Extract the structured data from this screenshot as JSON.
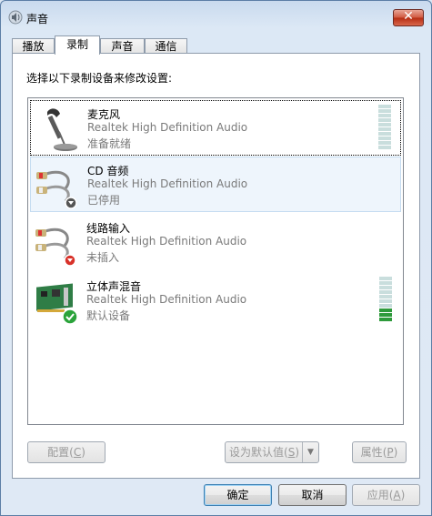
{
  "window": {
    "title": "声音",
    "close_label": "✕"
  },
  "tabs": [
    {
      "label": "播放",
      "active": false
    },
    {
      "label": "录制",
      "active": true
    },
    {
      "label": "声音",
      "active": false
    },
    {
      "label": "通信",
      "active": false
    }
  ],
  "prompt": "选择以下录制设备来修改设置:",
  "devices": [
    {
      "name": "麦克风",
      "description": "Realtek High Definition Audio",
      "status": "准备就绪",
      "icon": "microphone-icon",
      "level": 0,
      "has_meter": true
    },
    {
      "name": "CD 音频",
      "description": "Realtek High Definition Audio",
      "status": "已停用",
      "icon": "rca-cable-icon",
      "badge": "disabled-down-arrow-badge",
      "has_meter": false
    },
    {
      "name": "线路输入",
      "description": "Realtek High Definition Audio",
      "status": "未插入",
      "icon": "rca-cable-icon",
      "badge": "unplugged-red-down-arrow-badge",
      "has_meter": false
    },
    {
      "name": "立体声混音",
      "description": "Realtek High Definition Audio",
      "status": "默认设备",
      "icon": "sound-card-icon",
      "badge": "default-device-check-badge",
      "level": 0.3,
      "has_meter": true
    }
  ],
  "buttons": {
    "configure": {
      "label": "配置",
      "key": "C",
      "enabled": false
    },
    "set_default": {
      "label": "设为默认值",
      "key": "S",
      "enabled": false
    },
    "properties": {
      "label": "属性",
      "key": "P",
      "enabled": false
    },
    "ok": {
      "label": "确定",
      "enabled": true
    },
    "cancel": {
      "label": "取消",
      "enabled": true
    },
    "apply": {
      "label": "应用",
      "key": "A",
      "enabled": false
    }
  },
  "colors": {
    "meter_on": "#2e9a3b",
    "meter_off": "#c9dedd",
    "selection": "#eef5fc"
  }
}
